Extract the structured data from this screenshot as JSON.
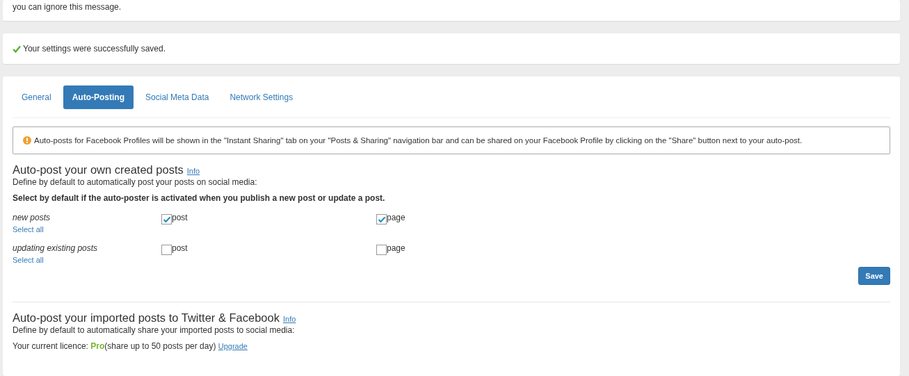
{
  "notice": {
    "text": "you can ignore this message."
  },
  "success": {
    "text": "Your settings were successfully saved."
  },
  "tabs": [
    {
      "label": "General",
      "selected": false
    },
    {
      "label": "Auto-Posting",
      "selected": true
    },
    {
      "label": "Social Meta Data",
      "selected": false
    },
    {
      "label": "Network Settings",
      "selected": false
    }
  ],
  "alert": {
    "text": "Auto-posts for Facebook Profiles will be shown in the \"Instant Sharing\" tab on your \"Posts & Sharing\" navigation bar and can be shared on your Facebook Profile by clicking on the \"Share\" button next to your auto-post."
  },
  "own_posts": {
    "title": "Auto-post your own created posts",
    "info": "Info",
    "description": "Define by default to automatically post your posts on social media:",
    "instruction": "Select by default if the auto-poster is activated when you publish a new post or update a post.",
    "rows": [
      {
        "label": "new posts",
        "select_all": "Select all",
        "options": [
          {
            "label": "post",
            "checked": true
          },
          {
            "label": "page",
            "checked": true
          }
        ]
      },
      {
        "label": "updating existing posts",
        "select_all": "Select all",
        "options": [
          {
            "label": "post",
            "checked": false
          },
          {
            "label": "page",
            "checked": false
          }
        ]
      }
    ],
    "save": "Save"
  },
  "imported_posts": {
    "title": "Auto-post your imported posts to Twitter & Facebook",
    "info": "Info",
    "description": "Define by default to automatically share your imported posts to social media:",
    "licence": {
      "label": "Your current licence: ",
      "plan": "Pro",
      "note": "(share up to 50 posts per day)",
      "upgrade": "Upgrade"
    }
  }
}
